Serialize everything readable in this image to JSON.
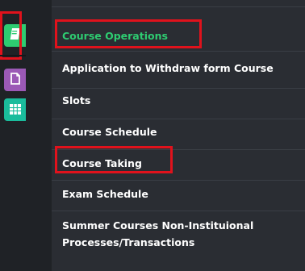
{
  "rail": {
    "icons": [
      {
        "name": "book-icon",
        "color": "#2ecc71",
        "highlighted": true
      },
      {
        "name": "file-icon",
        "color": "#9b59b6",
        "highlighted": false
      },
      {
        "name": "grid-icon",
        "color": "#1abc9c",
        "highlighted": false
      }
    ],
    "highlight_color": "#e0121c"
  },
  "menu": {
    "items": [
      {
        "label": "Course Operations",
        "active": true,
        "highlighted": true
      },
      {
        "label": "Application to Withdraw form Course",
        "active": false,
        "highlighted": false
      },
      {
        "label": "Slots",
        "active": false,
        "highlighted": false
      },
      {
        "label": "Course Schedule",
        "active": false,
        "highlighted": false
      },
      {
        "label": "Course Taking",
        "active": false,
        "highlighted": true
      },
      {
        "label": "Exam Schedule",
        "active": false,
        "highlighted": false
      },
      {
        "label": "Summer Courses Non-Instituional Processes/Transactions",
        "active": false,
        "highlighted": false
      }
    ],
    "active_color": "#2ecc71",
    "text_color": "#ffffff",
    "background": "#2a2d33"
  }
}
